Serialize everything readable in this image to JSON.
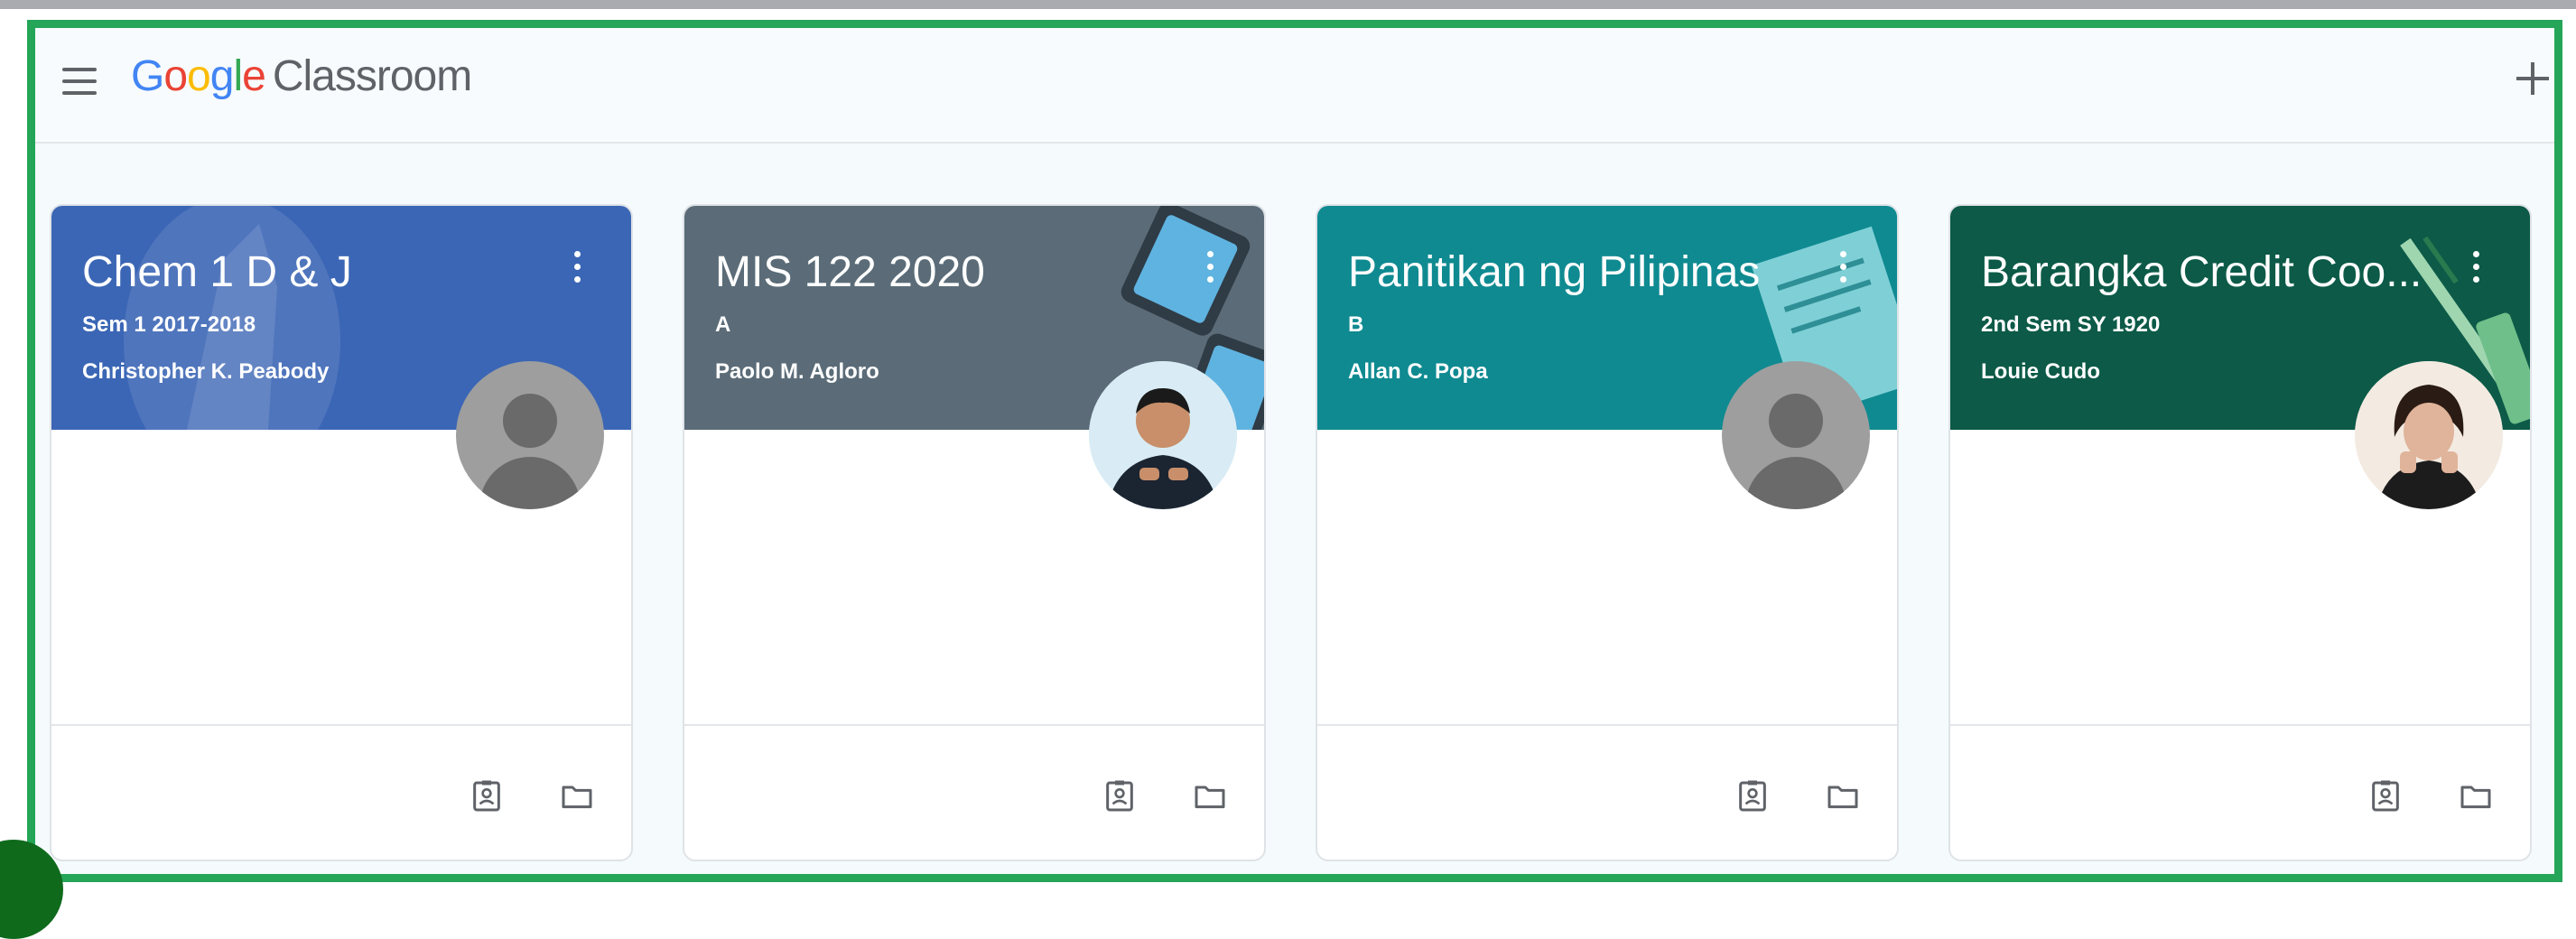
{
  "app": {
    "brand_google": [
      "G",
      "o",
      "o",
      "g",
      "l",
      "e"
    ],
    "brand_google_colors": [
      "#4285F4",
      "#EA4335",
      "#FBBC05",
      "#4285F4",
      "#34A853",
      "#EA4335"
    ],
    "brand_product": "Classroom",
    "menu_icon": "hamburger-menu-icon",
    "add_icon": "add-icon"
  },
  "cards": [
    {
      "title": "Chem 1 D & J",
      "section": "Sem 1 2017-2018",
      "teacher": "Christopher K. Peabody",
      "header_color": "#3b66b5",
      "avatar": "default-avatar"
    },
    {
      "title": "MIS 122 2020",
      "section": "A",
      "teacher": "Paolo M. Agloro",
      "header_color": "#5b6c78",
      "avatar": "photo-avatar"
    },
    {
      "title": "Panitikan ng Pilipinas",
      "section": "B",
      "teacher": "Allan C. Popa",
      "header_color": "#0f8a91",
      "avatar": "default-avatar"
    },
    {
      "title": "Barangka Credit Coo...",
      "section": "2nd Sem SY 1920",
      "teacher": "Louie Cudo",
      "header_color": "#0c5a47",
      "avatar": "photo-avatar"
    }
  ],
  "footer_icons": [
    "assignment-icon",
    "folder-icon"
  ],
  "colors": {
    "frame_border": "#25a558",
    "text_secondary": "#5f6368"
  }
}
